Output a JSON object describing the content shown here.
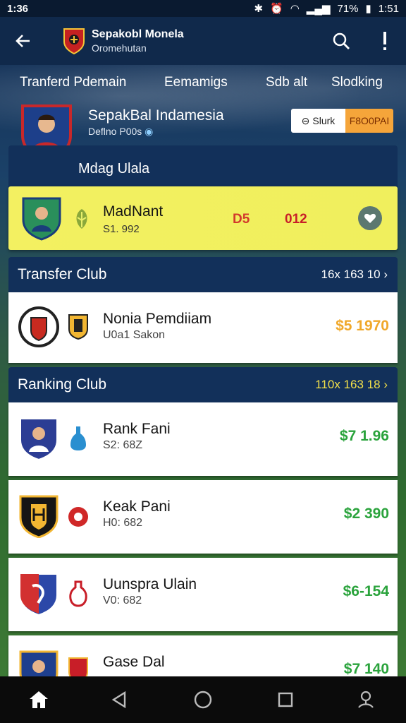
{
  "status_bar": {
    "time": "1:36",
    "battery": "71%",
    "clock": "1:51"
  },
  "app_bar": {
    "title": "Sepakobl Monela",
    "subtitle": "Oromehutan"
  },
  "tabs": [
    "Tranferd Pdemain",
    "Eemamigs",
    "Sdb alt",
    "Slodking"
  ],
  "club": {
    "name": "SepakBal Indamesia",
    "subtitle": "Deflno P00s",
    "toggle_left": "Slurk",
    "toggle_right": "F8O0PAI"
  },
  "featured_section": {
    "title": "Mdag Ulala"
  },
  "featured": {
    "name": "MadNant",
    "sub": "S1. 992",
    "value1": "D5",
    "value2": "012"
  },
  "transfer_section": {
    "title": "Transfer Club",
    "meta": "16x 163 10 ›"
  },
  "transfer_rows": [
    {
      "name": "Nonia Pemdiiam",
      "sub": "U0a1 Sakon",
      "value": "$5 1970"
    }
  ],
  "ranking_section": {
    "title": "Ranking Club",
    "meta": "110x 163 18 ›"
  },
  "ranking_rows": [
    {
      "name": "Rank Fani",
      "sub": "S2: 68Z",
      "value": "$7 1.96"
    },
    {
      "name": "Keak Pani",
      "sub": "H0: 682",
      "value": "$2 390"
    },
    {
      "name": "Uunspra Ulain",
      "sub": "V0: 682",
      "value": "$6-154"
    },
    {
      "name": "Gase Dal",
      "sub": "",
      "value": "$7 140"
    }
  ],
  "colors": {
    "header": "#10294b",
    "section": "#12305a",
    "featured": "#f3f061",
    "value_green": "#2aa33c",
    "accent_orange": "#f5a53a"
  }
}
